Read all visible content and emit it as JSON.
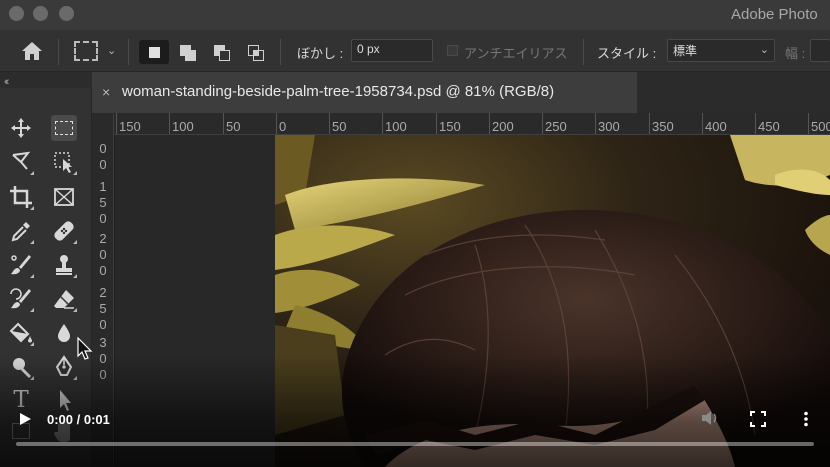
{
  "window": {
    "app_title": "Adobe Photo"
  },
  "options_bar": {
    "blur_label": "ぼかし :",
    "blur_value": "0 px",
    "antialias_label": "アンチエイリアス",
    "style_label": "スタイル :",
    "style_value": "標準",
    "width_label": "幅 :"
  },
  "document": {
    "tab_title": "woman-standing-beside-palm-tree-1958734.psd @ 81% (RGB/8)",
    "close_symbol": "×"
  },
  "rulers": {
    "horizontal": [
      "150",
      "100",
      "50",
      "0",
      "50",
      "100",
      "150",
      "200",
      "250",
      "300",
      "350",
      "400",
      "450",
      "500"
    ],
    "vertical_digits": [
      "0",
      "0",
      "1",
      "5",
      "0",
      "2",
      "0",
      "0",
      "2",
      "5",
      "0",
      "3",
      "0",
      "0"
    ]
  },
  "toolbar": {
    "collapse_symbol": "‹‹",
    "tools": [
      "move-tool",
      "rectangular-marquee-tool",
      "lasso-tool",
      "object-selection-tool",
      "crop-tool",
      "frame-tool",
      "eyedropper-tool",
      "spot-healing-brush-tool",
      "brush-tool",
      "clone-stamp-tool",
      "history-brush-tool",
      "eraser-tool",
      "paint-bucket-tool",
      "blur-tool",
      "dodge-tool",
      "pen-tool",
      "type-tool",
      "path-selection-tool"
    ],
    "active_tool": "rectangular-marquee-tool",
    "type_tool_glyph": "T"
  },
  "video": {
    "timecode": "0:00 / 0:01",
    "progress": 0.0
  },
  "colors": {
    "title_bar": "#3a3a3a",
    "panel": "#323232",
    "canvas_bg": "#282828"
  }
}
